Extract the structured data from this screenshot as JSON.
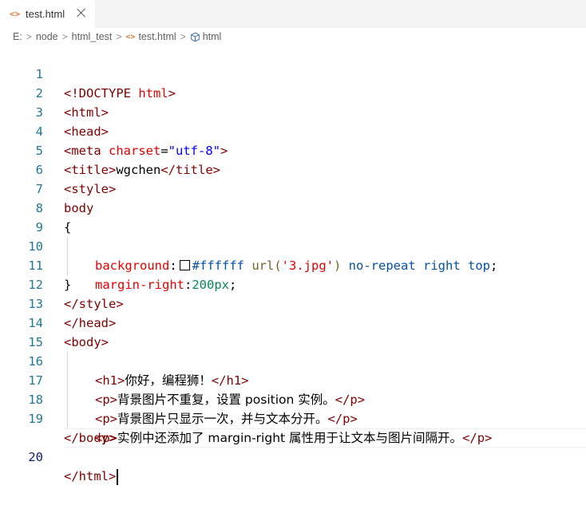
{
  "tab": {
    "icon": "<>",
    "label": "test.html"
  },
  "breadcrumb": {
    "items": [
      "E:",
      "node",
      "html_test",
      "test.html",
      "html"
    ]
  },
  "editor": {
    "line_numbers": [
      "1",
      "2",
      "3",
      "4",
      "5",
      "6",
      "7",
      "8",
      "9",
      "10",
      "11",
      "12",
      "13",
      "14",
      "15",
      "16",
      "17",
      "18",
      "19",
      "20"
    ],
    "active_line": "20",
    "lines": {
      "l1_a": "<!DOCTYPE",
      "l1_b": " html",
      "l1_c": ">",
      "l2": "<html>",
      "l3": "<head>",
      "l4_a": "<meta",
      "l4_b": " charset",
      "l4_c": "=",
      "l4_d": "\"utf-8\"",
      "l4_e": ">",
      "l5_a": "<title>",
      "l5_b": "wgchen",
      "l5_c": "</title>",
      "l6": "<style>",
      "l7": "body",
      "l8": "{",
      "l9_prop": "background",
      "l9_colon": ":",
      "l9_color": "#ffffff",
      "l9_func": " url(",
      "l9_str": "'3.jpg'",
      "l9_close": ")",
      "l9_kw": " no-repeat right top",
      "l9_semi": ";",
      "l10_prop": "margin-right",
      "l10_colon": ":",
      "l10_num": "200px",
      "l10_semi": ";",
      "l11": "}",
      "l12": "</style>",
      "l13": "</head>",
      "l14": "<body>",
      "l15_a": "<h1>",
      "l15_b": "你好，编程狮！",
      "l15_c": "</h1>",
      "l16_a": "<p>",
      "l16_b": "背景图片不重复，设置 position 实例。",
      "l16_c": "</p>",
      "l17_a": "<p>",
      "l17_b": "背景图片只显示一次，并与文本分开。",
      "l17_c": "</p>",
      "l18_a": "<p>",
      "l18_b": "实例中还添加了 margin-right 属性用于让文本与图片间隔开。",
      "l18_c": "</p>",
      "l19": "</body>",
      "l20_a": "</",
      "l20_b": "html",
      "l20_c": ">"
    }
  },
  "colors": {
    "tag": "#800000",
    "attribute": "#e50000",
    "string": "#0000ff",
    "keyword": "#0451a5",
    "number": "#098658",
    "line_number": "#237893"
  }
}
